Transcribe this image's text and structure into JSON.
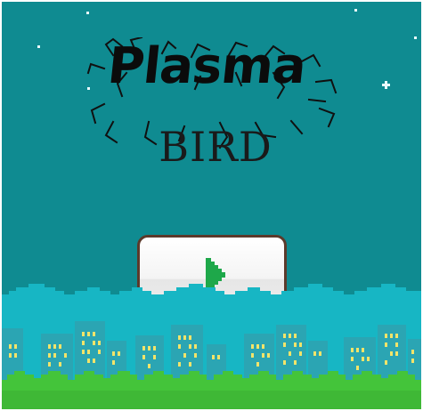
{
  "game": {
    "title_line1": "Plasma",
    "title_line2": "BIRD"
  },
  "play_button": {
    "icon": "play-triangle-icon",
    "icon_color": "#1ea84a"
  },
  "colors": {
    "sky": "#0f8b91",
    "clouds": "#17b6c4",
    "buildings": "#2ba5b3",
    "windows": "#f2e46a",
    "bushes": "#44c43a"
  }
}
